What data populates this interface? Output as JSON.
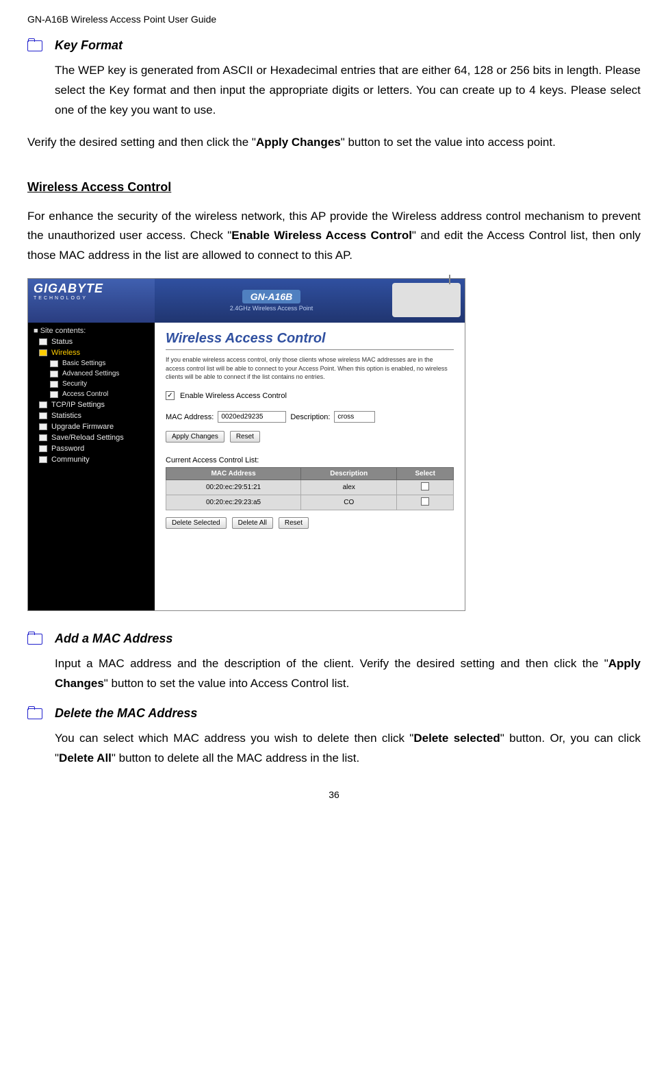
{
  "header": "GN-A16B Wireless Access Point User Guide",
  "sections": {
    "keyFormat": {
      "title": "Key Format",
      "body": "The WEP key is generated from ASCII or Hexadecimal entries that are either 64, 128 or 256 bits in length. Please select the Key format and then input the appropriate digits or letters. You can create up to 4 keys. Please select one of the key you want to use."
    },
    "verify": {
      "pre": "Verify the desired setting and then click the \"",
      "bold": "Apply Changes",
      "post": "\" button to set the value into access point."
    },
    "wirelessHeading": "Wireless Access Control",
    "wirelessDesc": {
      "part1": "For enhance the security of the wireless network, this AP provide the Wireless address control mechanism to prevent the unauthorized user access.  Check \"",
      "bold1": "Enable Wireless Access Control",
      "part2": "\" and edit the Access Control list, then only those MAC address in the list are allowed to connect to this AP."
    },
    "addMac": {
      "title": "Add a MAC Address",
      "pre": "Input a MAC address and the description of the client. Verify the desired setting and then click the \"",
      "bold": "Apply Changes",
      "post": "\" button to set the value into Access Control list."
    },
    "deleteMac": {
      "title": "Delete the MAC Address",
      "pre": "You can select which MAC address you wish to delete then click \"",
      "bold1": "Delete selected",
      "mid": "\" button. Or, you can click \"",
      "bold2": "Delete All",
      "post": "\" button to delete all the MAC address in the list."
    }
  },
  "screenshot": {
    "logo": "GIGABYTE",
    "logoSub": "TECHNOLOGY",
    "model": "GN-A16B",
    "modelSub": "2.4GHz Wireless Access Point",
    "sidebarTitle": "Site contents:",
    "nav": [
      "Status",
      "Wireless",
      "Basic Settings",
      "Advanced Settings",
      "Security",
      "Access Control",
      "TCP/IP Settings",
      "Statistics",
      "Upgrade Firmware",
      "Save/Reload Settings",
      "Password",
      "Community"
    ],
    "mainTitle": "Wireless Access Control",
    "desc": "If you enable wireless access control, only those clients whose wireless MAC addresses are in the access control list will be able to connect to your Access Point. When this option is enabled, no wireless clients will be able to connect if the list contains no entries.",
    "checkboxLabel": "Enable Wireless Access Control",
    "macLabel": "MAC Address:",
    "macValue": "0020ed29235",
    "descLabel": "Description:",
    "descValue": "cross",
    "btn1": "Apply Changes",
    "btn2": "Reset",
    "tableTitle": "Current Access Control List:",
    "tableHeaders": [
      "MAC Address",
      "Description",
      "Select"
    ],
    "tableRows": [
      {
        "mac": "00:20:ec:29:51:21",
        "desc": "alex"
      },
      {
        "mac": "00:20:ec:29:23:a5",
        "desc": "CO"
      }
    ],
    "btnDeleteSelected": "Delete Selected",
    "btnDeleteAll": "Delete All",
    "btnReset": "Reset"
  },
  "pageNumber": "36"
}
